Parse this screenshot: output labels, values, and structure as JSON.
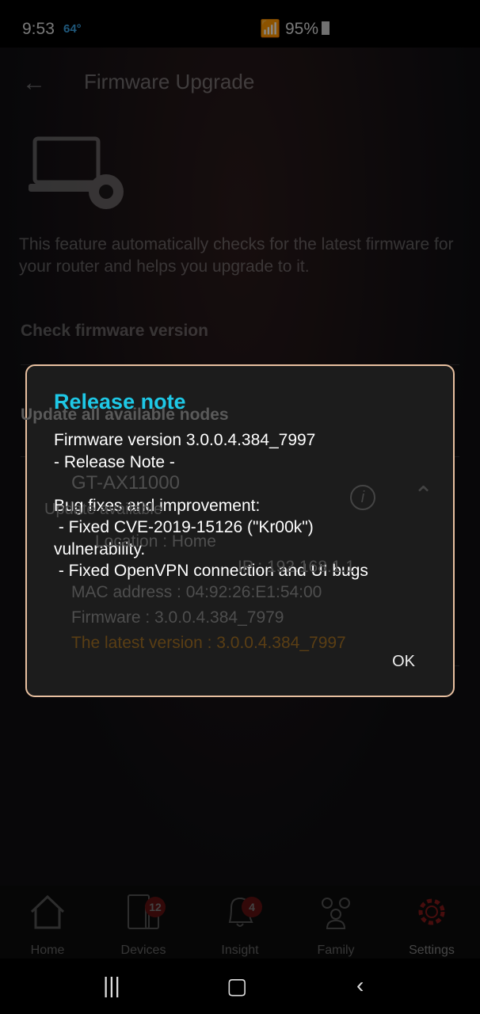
{
  "status_bar": {
    "time": "9:53",
    "temperature": "64°",
    "battery": "95%"
  },
  "header": {
    "title": "Firmware Upgrade"
  },
  "description": "This feature automatically checks for the latest firmware for your router and helps you upgrade to it.",
  "sections": {
    "check": "Check firmware version",
    "update_all": "Update all available nodes"
  },
  "node": {
    "name": "GT-AX11000",
    "status": "Update available",
    "location": "Location : Home",
    "ip": "IP : 192.168.1.1",
    "mac": "MAC address : 04:92:26:E1:54:00",
    "firmware": "Firmware : 3.0.0.4.384_7979",
    "latest": "The latest version : 3.0.0.4.384_7997"
  },
  "dialog": {
    "title": "Release note",
    "body": "Firmware version 3.0.0.4.384_7997\n- Release Note -\n\nBug fixes and improvement:\n - Fixed CVE-2019-15126 (\"Kr00k\")\nvulnerability.\n - Fixed OpenVPN connection and UI bugs",
    "ok": "OK"
  },
  "nav": [
    {
      "label": "Home",
      "icon": "home-icon"
    },
    {
      "label": "Devices",
      "icon": "devices-icon",
      "badge": "12"
    },
    {
      "label": "Insight",
      "icon": "bell-icon",
      "badge": "4"
    },
    {
      "label": "Family",
      "icon": "family-icon"
    },
    {
      "label": "Settings",
      "icon": "gear-icon",
      "active": true
    }
  ],
  "colors": {
    "accent": "#1ec8e6",
    "active_nav": "#c01818",
    "latest_version": "#c88a2a"
  }
}
